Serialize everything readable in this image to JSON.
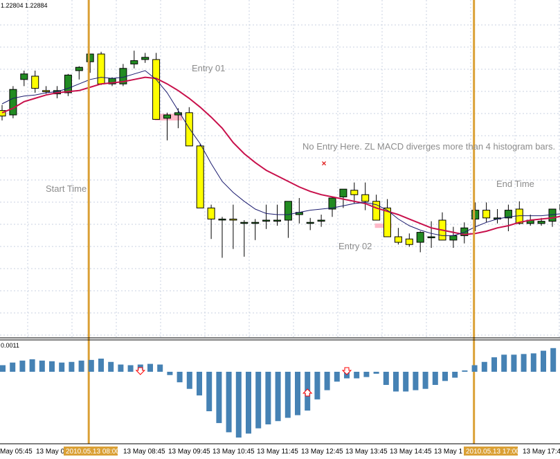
{
  "chart_data": [
    {
      "type": "candlestick",
      "price_readout": "1.22804 1.22884",
      "colors": {
        "background": "#ffffff",
        "grid": "#c8d2e0",
        "bull": "#228b22",
        "bear": "#ffff00",
        "wick": "#000000",
        "ema_slow": "#c8104b",
        "ema_fast": "#1a1a6e",
        "session_line": "#daa035",
        "entry_zone": "#ffb8c8"
      },
      "y_range": [
        0,
        100
      ],
      "candles": [
        {
          "o": 44,
          "h": 49,
          "l": 35,
          "c": 39
        },
        {
          "o": 40,
          "h": 66,
          "l": 37,
          "c": 63
        },
        {
          "o": 72,
          "h": 80,
          "l": 66,
          "c": 77
        },
        {
          "o": 75,
          "h": 80,
          "l": 60,
          "c": 64
        },
        {
          "o": 62,
          "h": 66,
          "l": 59,
          "c": 61
        },
        {
          "o": 59,
          "h": 66,
          "l": 55,
          "c": 62
        },
        {
          "o": 60,
          "h": 77,
          "l": 57,
          "c": 76
        },
        {
          "o": 80,
          "h": 84,
          "l": 72,
          "c": 83
        },
        {
          "o": 88,
          "h": 92,
          "l": 78,
          "c": 95
        },
        {
          "o": 95,
          "h": 97,
          "l": 67,
          "c": 68
        },
        {
          "o": 68,
          "h": 74,
          "l": 66,
          "c": 73
        },
        {
          "o": 68,
          "h": 86,
          "l": 66,
          "c": 82
        },
        {
          "o": 86,
          "h": 98,
          "l": 82,
          "c": 89
        },
        {
          "o": 90,
          "h": 96,
          "l": 87,
          "c": 92
        },
        {
          "o": 90,
          "h": 96,
          "l": 36,
          "c": 36
        },
        {
          "o": 37,
          "h": 42,
          "l": 17,
          "c": 40
        },
        {
          "o": 40,
          "h": 46,
          "l": 28,
          "c": 42
        },
        {
          "o": 42,
          "h": 47,
          "l": 12,
          "c": 12
        },
        {
          "o": 12,
          "h": 14,
          "l": -42,
          "c": -44
        },
        {
          "o": -44,
          "h": -41,
          "l": -72,
          "c": -54
        },
        {
          "o": -54,
          "h": -52,
          "l": -89,
          "c": -54
        },
        {
          "o": -54,
          "h": -41,
          "l": -81,
          "c": -55
        },
        {
          "o": -57,
          "h": -55,
          "l": -88,
          "c": -57
        },
        {
          "o": -57,
          "h": -54,
          "l": -73,
          "c": -57
        },
        {
          "o": -55,
          "h": -41,
          "l": -63,
          "c": -55
        },
        {
          "o": -55,
          "h": -41,
          "l": -60,
          "c": -55
        },
        {
          "o": -55,
          "h": -46,
          "l": -71,
          "c": -38
        },
        {
          "o": -50,
          "h": -35,
          "l": -58,
          "c": -48
        },
        {
          "o": -57,
          "h": -53,
          "l": -64,
          "c": -57
        },
        {
          "o": -55,
          "h": -50,
          "l": -61,
          "c": -55
        },
        {
          "o": -45,
          "h": -40,
          "l": -52,
          "c": -35
        },
        {
          "o": -34,
          "h": -28,
          "l": -44,
          "c": -27
        },
        {
          "o": -28,
          "h": -21,
          "l": -40,
          "c": -32
        },
        {
          "o": -32,
          "h": -21,
          "l": -46,
          "c": -38
        },
        {
          "o": -38,
          "h": -32,
          "l": -48,
          "c": -55
        },
        {
          "o": -44,
          "h": -36,
          "l": -59,
          "c": -70
        },
        {
          "o": -70,
          "h": -62,
          "l": -77,
          "c": -75
        },
        {
          "o": -72,
          "h": -67,
          "l": -79,
          "c": -77
        },
        {
          "o": -75,
          "h": -65,
          "l": -84,
          "c": -66
        },
        {
          "o": -70,
          "h": -56,
          "l": -80,
          "c": -70
        },
        {
          "o": -55,
          "h": -48,
          "l": -72,
          "c": -73
        },
        {
          "o": -73,
          "h": -61,
          "l": -80,
          "c": -69
        },
        {
          "o": -69,
          "h": -57,
          "l": -76,
          "c": -62
        },
        {
          "o": -54,
          "h": -39,
          "l": -65,
          "c": -46
        },
        {
          "o": -46,
          "h": -39,
          "l": -57,
          "c": -53
        },
        {
          "o": -53,
          "h": -45,
          "l": -58,
          "c": -53
        },
        {
          "o": -53,
          "h": -41,
          "l": -65,
          "c": -46
        },
        {
          "o": -45,
          "h": -38,
          "l": -59,
          "c": -58
        },
        {
          "o": -58,
          "h": -50,
          "l": -60,
          "c": -55
        },
        {
          "o": -58,
          "h": -53,
          "l": -60,
          "c": -56
        },
        {
          "o": -56,
          "h": -46,
          "l": -61,
          "c": -45
        },
        {
          "o": -46,
          "h": -38,
          "l": -52,
          "c": -41
        }
      ],
      "ema_slow": [
        42,
        46,
        52,
        55,
        58,
        60,
        61,
        62,
        65,
        68,
        69,
        70,
        72,
        74,
        73,
        68,
        62,
        55,
        47,
        38,
        28,
        15,
        5,
        -3,
        -10,
        -15,
        -20,
        -25,
        -29,
        -32,
        -34,
        -36,
        -38,
        -40,
        -44,
        -47,
        -50,
        -54,
        -58,
        -62,
        -64,
        -66,
        -68,
        -67,
        -65,
        -62,
        -60,
        -57,
        -55,
        -54,
        -53,
        -51
      ],
      "ema_fast": [
        50,
        55,
        57,
        58,
        60,
        61,
        64,
        68,
        72,
        74,
        73,
        74,
        77,
        80,
        72,
        60,
        44,
        28,
        14,
        -4,
        -20,
        -30,
        -38,
        -45,
        -49,
        -50,
        -50,
        -48,
        -46,
        -45,
        -44,
        -42,
        -40,
        -39,
        -41,
        -46,
        -54,
        -60,
        -64,
        -67,
        -69,
        -69,
        -66,
        -61,
        -57,
        -54,
        -52,
        -51,
        -51,
        -51,
        -50,
        -49
      ],
      "entry_zones": [
        {
          "label": "Entry 01",
          "candle_from": 14,
          "candle_to": 16,
          "y_top": 41,
          "y_bottom": 35
        },
        {
          "label": "Entry 02",
          "candle_from": 34,
          "candle_to": 35,
          "y_top": -58,
          "y_bottom": -62
        }
      ],
      "session_lines": [
        {
          "label": "Start Time",
          "candle": 8
        },
        {
          "label": "End Time",
          "candle": 43
        }
      ],
      "annotations": [
        {
          "text": "Entry 01"
        },
        {
          "text": "Entry 02"
        },
        {
          "text": "No Entry Here. ZL MACD diverges more than 4 histogram bars."
        },
        {
          "text": "Start Time"
        },
        {
          "text": "End Time"
        }
      ],
      "x_marker": {
        "candle": 29,
        "symbol": "×"
      }
    },
    {
      "type": "bar",
      "indicator_readout": "0.0011",
      "colors": {
        "bar": "#4682b4",
        "arrow": "#ff0000"
      },
      "y_range": [
        -100,
        40
      ],
      "values": [
        10,
        14,
        17,
        19,
        17,
        16,
        14,
        15,
        17,
        18,
        20,
        15,
        11,
        10,
        11,
        12,
        11,
        -5,
        -16,
        -26,
        -36,
        -60,
        -78,
        -92,
        -100,
        -94,
        -86,
        -80,
        -75,
        -70,
        -66,
        -59,
        -42,
        -28,
        -15,
        -10,
        -10,
        -8,
        -3,
        -20,
        -30,
        -30,
        -28,
        -26,
        -20,
        -14,
        -9,
        2,
        10,
        15,
        22,
        26,
        26,
        27,
        28,
        32,
        36
      ],
      "arrows": [
        {
          "bar": 14,
          "direction": "down"
        },
        {
          "bar": 31,
          "direction": "up"
        },
        {
          "bar": 35,
          "direction": "down"
        }
      ],
      "x_ticks": [
        "May 05:45",
        "13 May 0",
        "13 May 08:45",
        "13 May 09:45",
        "13 May 10:45",
        "13 May 11:45",
        "13 May 12:45",
        "13 May 13:45",
        "13 May 14:45",
        "13 May 1",
        "13 May 17:45"
      ],
      "highlighted_ticks": [
        "2010.05.13 08:00",
        "2010.05.13 17:00"
      ]
    }
  ]
}
